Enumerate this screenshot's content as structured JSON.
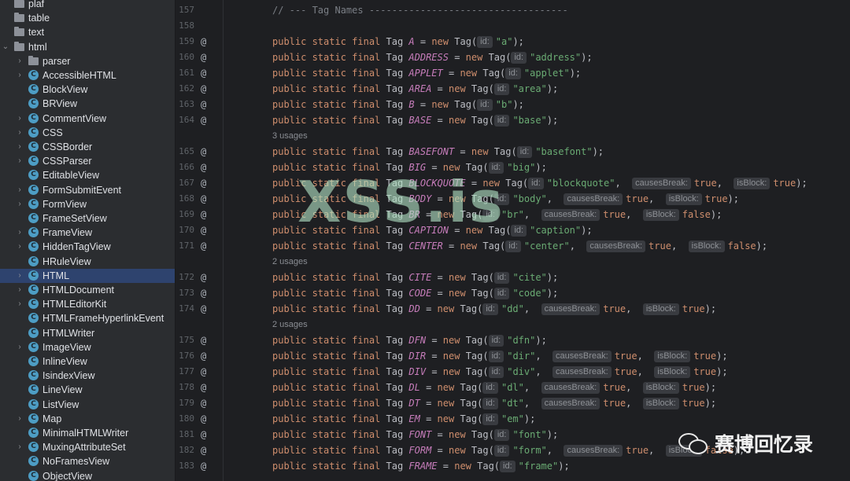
{
  "project_tree": {
    "items": [
      {
        "label": "plaf",
        "kind": "folder",
        "expand": "",
        "indent": 0,
        "selected": false
      },
      {
        "label": "table",
        "kind": "folder",
        "expand": "",
        "indent": 0,
        "selected": false
      },
      {
        "label": "text",
        "kind": "folder",
        "expand": "",
        "indent": 0,
        "selected": false
      },
      {
        "label": "html",
        "kind": "folder",
        "expand": "open",
        "indent": 0,
        "selected": false
      },
      {
        "label": "parser",
        "kind": "folder",
        "expand": "closed",
        "indent": 1,
        "selected": false
      },
      {
        "label": "AccessibleHTML",
        "kind": "class",
        "expand": "closed",
        "indent": 1,
        "selected": false
      },
      {
        "label": "BlockView",
        "kind": "class",
        "expand": "",
        "indent": 1,
        "selected": false
      },
      {
        "label": "BRView",
        "kind": "class",
        "expand": "",
        "indent": 1,
        "selected": false
      },
      {
        "label": "CommentView",
        "kind": "class",
        "expand": "closed",
        "indent": 1,
        "selected": false
      },
      {
        "label": "CSS",
        "kind": "class",
        "expand": "closed",
        "indent": 1,
        "selected": false
      },
      {
        "label": "CSSBorder",
        "kind": "class",
        "expand": "closed",
        "indent": 1,
        "selected": false
      },
      {
        "label": "CSSParser",
        "kind": "class",
        "expand": "closed",
        "indent": 1,
        "selected": false
      },
      {
        "label": "EditableView",
        "kind": "class",
        "expand": "",
        "indent": 1,
        "selected": false
      },
      {
        "label": "FormSubmitEvent",
        "kind": "class",
        "expand": "closed",
        "indent": 1,
        "selected": false
      },
      {
        "label": "FormView",
        "kind": "class",
        "expand": "closed",
        "indent": 1,
        "selected": false
      },
      {
        "label": "FrameSetView",
        "kind": "class",
        "expand": "",
        "indent": 1,
        "selected": false
      },
      {
        "label": "FrameView",
        "kind": "class",
        "expand": "closed",
        "indent": 1,
        "selected": false
      },
      {
        "label": "HiddenTagView",
        "kind": "class",
        "expand": "closed",
        "indent": 1,
        "selected": false
      },
      {
        "label": "HRuleView",
        "kind": "class",
        "expand": "",
        "indent": 1,
        "selected": false
      },
      {
        "label": "HTML",
        "kind": "class",
        "expand": "closed",
        "indent": 1,
        "selected": true
      },
      {
        "label": "HTMLDocument",
        "kind": "class",
        "expand": "closed",
        "indent": 1,
        "selected": false
      },
      {
        "label": "HTMLEditorKit",
        "kind": "class",
        "expand": "closed",
        "indent": 1,
        "selected": false
      },
      {
        "label": "HTMLFrameHyperlinkEvent",
        "kind": "class",
        "expand": "",
        "indent": 1,
        "selected": false
      },
      {
        "label": "HTMLWriter",
        "kind": "class",
        "expand": "",
        "indent": 1,
        "selected": false
      },
      {
        "label": "ImageView",
        "kind": "class",
        "expand": "closed",
        "indent": 1,
        "selected": false
      },
      {
        "label": "InlineView",
        "kind": "class",
        "expand": "",
        "indent": 1,
        "selected": false
      },
      {
        "label": "IsindexView",
        "kind": "class",
        "expand": "",
        "indent": 1,
        "selected": false
      },
      {
        "label": "LineView",
        "kind": "class",
        "expand": "",
        "indent": 1,
        "selected": false
      },
      {
        "label": "ListView",
        "kind": "class",
        "expand": "",
        "indent": 1,
        "selected": false
      },
      {
        "label": "Map",
        "kind": "class",
        "expand": "closed",
        "indent": 1,
        "selected": false
      },
      {
        "label": "MinimalHTMLWriter",
        "kind": "class",
        "expand": "",
        "indent": 1,
        "selected": false
      },
      {
        "label": "MuxingAttributeSet",
        "kind": "class",
        "expand": "closed",
        "indent": 1,
        "selected": false
      },
      {
        "label": "NoFramesView",
        "kind": "class",
        "expand": "",
        "indent": 1,
        "selected": false
      },
      {
        "label": "ObjectView",
        "kind": "class",
        "expand": "",
        "indent": 1,
        "selected": false
      }
    ]
  },
  "editor": {
    "lines": [
      {
        "type": "comment",
        "num": "157",
        "text": "// --- Tag Names -----------------------------------"
      },
      {
        "type": "blank",
        "num": "158"
      },
      {
        "type": "tag",
        "num": "159",
        "name": "A",
        "val": "\"a\""
      },
      {
        "type": "tag",
        "num": "160",
        "name": "ADDRESS",
        "val": "\"address\""
      },
      {
        "type": "tag",
        "num": "161",
        "name": "APPLET",
        "val": "\"applet\""
      },
      {
        "type": "tag",
        "num": "162",
        "name": "AREA",
        "val": "\"area\""
      },
      {
        "type": "tag",
        "num": "163",
        "name": "B",
        "val": "\"b\""
      },
      {
        "type": "tag",
        "num": "164",
        "name": "BASE",
        "val": "\"base\""
      },
      {
        "type": "usages",
        "text": "3 usages"
      },
      {
        "type": "tag",
        "num": "165",
        "name": "BASEFONT",
        "val": "\"basefont\""
      },
      {
        "type": "tag",
        "num": "166",
        "name": "BIG",
        "val": "\"big\""
      },
      {
        "type": "tag",
        "num": "167",
        "name": "BLOCKQUOTE",
        "val": "\"blockquote\"",
        "cb": "true",
        "ib": "true"
      },
      {
        "type": "tag",
        "num": "168",
        "name": "BODY",
        "val": "\"body\"",
        "cb": "true",
        "ib": "true"
      },
      {
        "type": "tag",
        "num": "169",
        "name": "BR",
        "val": "\"br\"",
        "cb": "true",
        "ib": "false"
      },
      {
        "type": "tag",
        "num": "170",
        "name": "CAPTION",
        "val": "\"caption\""
      },
      {
        "type": "tag",
        "num": "171",
        "name": "CENTER",
        "val": "\"center\"",
        "cb": "true",
        "ib": "false"
      },
      {
        "type": "usages",
        "text": "2 usages"
      },
      {
        "type": "tag",
        "num": "172",
        "name": "CITE",
        "val": "\"cite\""
      },
      {
        "type": "tag",
        "num": "173",
        "name": "CODE",
        "val": "\"code\""
      },
      {
        "type": "tag",
        "num": "174",
        "name": "DD",
        "val": "\"dd\"",
        "cb": "true",
        "ib": "true"
      },
      {
        "type": "usages",
        "text": "2 usages"
      },
      {
        "type": "tag",
        "num": "175",
        "name": "DFN",
        "val": "\"dfn\""
      },
      {
        "type": "tag",
        "num": "176",
        "name": "DIR",
        "val": "\"dir\"",
        "cb": "true",
        "ib": "true"
      },
      {
        "type": "tag",
        "num": "177",
        "name": "DIV",
        "val": "\"div\"",
        "cb": "true",
        "ib": "true"
      },
      {
        "type": "tag",
        "num": "178",
        "name": "DL",
        "val": "\"dl\"",
        "cb": "true",
        "ib": "true"
      },
      {
        "type": "tag",
        "num": "179",
        "name": "DT",
        "val": "\"dt\"",
        "cb": "true",
        "ib": "true"
      },
      {
        "type": "tag",
        "num": "180",
        "name": "EM",
        "val": "\"em\""
      },
      {
        "type": "tag",
        "num": "181",
        "name": "FONT",
        "val": "\"font\""
      },
      {
        "type": "tag",
        "num": "182",
        "name": "FORM",
        "val": "\"form\"",
        "cb": "true",
        "ib": "false"
      },
      {
        "type": "tag",
        "num": "183",
        "name": "FRAME",
        "val": "\"frame\""
      }
    ],
    "decl": {
      "mods": "public static final",
      "type": "Tag",
      "assign": "=",
      "kw_new": "new",
      "ctor": "Tag(",
      "close": ");",
      "comma": ","
    },
    "hints": {
      "id": "id:",
      "causes_break": "causesBreak:",
      "is_block": "isBlock:"
    },
    "gutter_marker": "@"
  },
  "watermark": {
    "text": "XSS.is"
  },
  "footer_badge": {
    "text": "赛博回忆录",
    "icon": "wechat-icon"
  },
  "colors": {
    "keyword": "#cf8e6d",
    "field": "#c77dbb",
    "string": "#6aab73",
    "comment": "#7a7e85",
    "selection": "#2e436e",
    "watermark": "#b2e2c4"
  }
}
